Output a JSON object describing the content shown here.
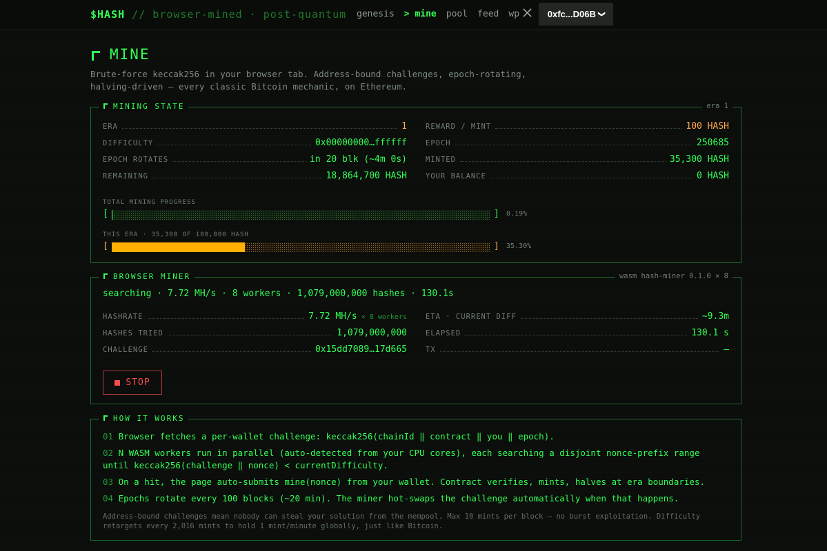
{
  "topbar": {
    "brand_main": "$HASH",
    "brand_sub": "// browser-mined · post-quantum",
    "nav": [
      "genesis",
      "> mine",
      "pool",
      "feed",
      "wp"
    ],
    "x_icon": "x-logo-icon",
    "wallet_label": "0xfc...D06B",
    "wallet_chevron": "❯"
  },
  "page": {
    "title": "MINE",
    "desc_line1": "Brute-force keccak256 in your browser tab. Address-bound challenges, epoch-rotating,",
    "desc_line2": "halving-driven — every classic Bitcoin mechanic, on Ethereum."
  },
  "mining_state": {
    "header": "MINING STATE",
    "header_right": "era 1",
    "left": [
      {
        "label": "ERA",
        "value": "1"
      },
      {
        "label": "DIFFICULTY",
        "value": "0x00000000…ffffff"
      },
      {
        "label": "EPOCH ROTATES",
        "value": "in 20 blk (~4m 0s)"
      },
      {
        "label": "REMAINING",
        "value": "18,864,700 HASH"
      }
    ],
    "right": [
      {
        "label": "REWARD / MINT",
        "value": "100 HASH"
      },
      {
        "label": "EPOCH",
        "value": "250685"
      },
      {
        "label": "MINTED",
        "value": "35,300 HASH"
      },
      {
        "label": "YOUR BALANCE",
        "value": "0 HASH"
      }
    ],
    "total_progress_label": "TOTAL MINING PROGRESS",
    "total_progress_pct": "0.19%",
    "total_progress_value": 0.0019,
    "era_progress_label": "THIS ERA · 35,300 OF 100,000 HASH",
    "era_progress_pct": "35.30%",
    "era_progress_value": 0.353,
    "bracket_open": "[",
    "bracket_close": "]"
  },
  "browser_miner": {
    "header": "BROWSER MINER",
    "header_right": "wasm hash-miner 0.1.0 × 8",
    "status": "searching · 7.72 MH/s · 8 workers · 1,079,000,000 hashes · 130.1s",
    "left": [
      {
        "label": "HASHRATE",
        "value": "7.72 MH/s",
        "sub": " × 8 workers"
      },
      {
        "label": "HASHES TRIED",
        "value": "1,079,000,000"
      },
      {
        "label": "CHALLENGE",
        "value": "0x15dd7089…17d665"
      }
    ],
    "right": [
      {
        "label": "ETA · CURRENT DIFF",
        "value": "~9.3m"
      },
      {
        "label": "ELAPSED",
        "value": "130.1 s"
      },
      {
        "label": "TX",
        "value": "—"
      }
    ],
    "stop_label": "STOP"
  },
  "how_it_works": {
    "header": "HOW IT WORKS",
    "steps": [
      {
        "n": "01",
        "text": "Browser fetches a per-wallet challenge: keccak256(chainId ‖ contract ‖ you ‖ epoch)."
      },
      {
        "n": "02",
        "text": "N WASM workers run in parallel (auto-detected from your CPU cores), each searching a disjoint nonce-prefix range until keccak256(challenge ‖ nonce) < currentDifficulty."
      },
      {
        "n": "03",
        "text": "On a hit, the page auto-submits mine(nonce) from your wallet. Contract verifies, mints, halves at era boundaries."
      },
      {
        "n": "04",
        "text": "Epochs rotate every 100 blocks (~20 min). The miner hot-swaps the challenge automatically when that happens."
      }
    ],
    "note": "Address-bound challenges mean nobody can steal your solution from the mempool. Max 10 mints per block — no burst exploitation. Difficulty retargets every 2,016 mints to hold 1 mint/minute globally, just like Bitcoin."
  },
  "colors": {
    "accent": "#33ff55",
    "orange": "#ffa94d",
    "danger": "#ff4d4d",
    "background": "#0b0d0b"
  }
}
